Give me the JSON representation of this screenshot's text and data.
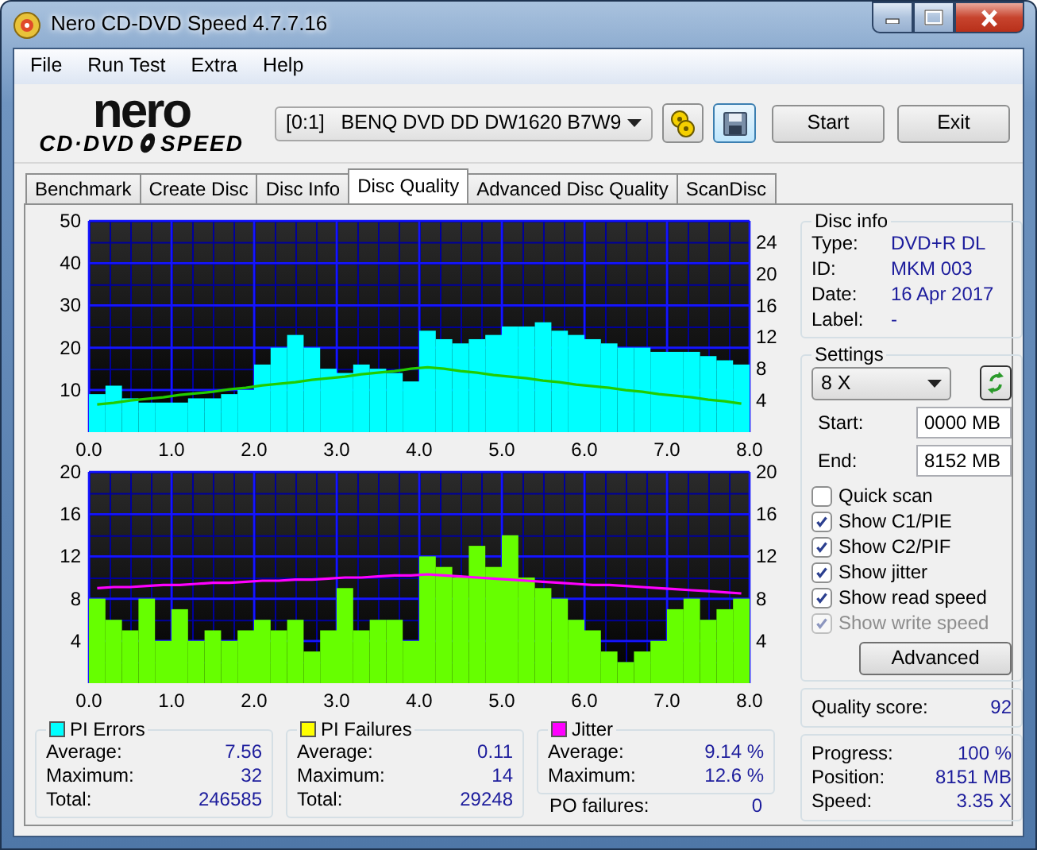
{
  "window": {
    "title": "Nero CD-DVD Speed 4.7.7.16"
  },
  "menu": [
    "File",
    "Run Test",
    "Extra",
    "Help"
  ],
  "logo": {
    "top": "nero",
    "bottom_left": "CD·DVD",
    "bottom_right": "SPEED"
  },
  "toolbar": {
    "drive": "[0:1]   BENQ DVD DD DW1620 B7W9",
    "buttons": [
      "Start",
      "Exit"
    ]
  },
  "tabs": [
    {
      "label": "Benchmark",
      "selected": false
    },
    {
      "label": "Create Disc",
      "selected": false
    },
    {
      "label": "Disc Info",
      "selected": false
    },
    {
      "label": "Disc Quality",
      "selected": true
    },
    {
      "label": "Advanced Disc Quality",
      "selected": false
    },
    {
      "label": "ScanDisc",
      "selected": false
    }
  ],
  "charts": [
    {
      "chart_data": {
        "type": "bar",
        "grid": true,
        "x": [
          0.1,
          0.3,
          0.5,
          0.7,
          0.9,
          1.1,
          1.3,
          1.5,
          1.7,
          1.9,
          2.1,
          2.3,
          2.5,
          2.7,
          2.9,
          3.1,
          3.3,
          3.5,
          3.7,
          3.9,
          4.1,
          4.3,
          4.5,
          4.7,
          4.9,
          5.1,
          5.3,
          5.5,
          5.7,
          5.9,
          6.1,
          6.3,
          6.5,
          6.7,
          6.9,
          7.1,
          7.3,
          7.5,
          7.7,
          7.9
        ],
        "xlim": [
          0,
          8
        ],
        "ylim": [
          0,
          50
        ],
        "y2lim": [
          0,
          26.7
        ],
        "xticks": [
          {
            "value": 0,
            "label": "0.0"
          },
          {
            "value": 1,
            "label": "1.0"
          },
          {
            "value": 2,
            "label": "2.0"
          },
          {
            "value": 3,
            "label": "3.0"
          },
          {
            "value": 4,
            "label": "4.0"
          },
          {
            "value": 5,
            "label": "5.0"
          },
          {
            "value": 6,
            "label": "6.0"
          },
          {
            "value": 7,
            "label": "7.0"
          },
          {
            "value": 8,
            "label": "8.0"
          }
        ],
        "yticks": [
          10,
          20,
          30,
          40,
          50
        ],
        "y2ticks": [
          4,
          8,
          12,
          16,
          20,
          24
        ],
        "series": [
          {
            "type": "bar",
            "color": "#00ffff",
            "values": [
              9,
              11,
              8,
              7,
              7,
              7,
              8,
              8,
              9,
              10,
              16,
              20,
              23,
              20,
              15,
              14,
              16,
              15,
              14,
              12,
              24,
              22,
              21,
              22,
              23,
              25,
              25,
              26,
              24,
              23,
              22,
              21,
              20,
              20,
              19,
              19,
              19,
              18,
              17,
              16
            ]
          },
          {
            "type": "line",
            "axis": "y2",
            "color": "#22cc00",
            "values": [
              3.5,
              3.7,
              4.0,
              4.2,
              4.4,
              4.7,
              4.9,
              5.1,
              5.4,
              5.6,
              5.9,
              6.1,
              6.3,
              6.6,
              6.8,
              7.0,
              7.3,
              7.5,
              7.7,
              8.0,
              8.2,
              8.0,
              7.7,
              7.5,
              7.2,
              7.0,
              6.8,
              6.5,
              6.3,
              6.0,
              5.8,
              5.6,
              5.3,
              5.1,
              4.8,
              4.6,
              4.4,
              4.1,
              3.9,
              3.6
            ]
          }
        ]
      }
    },
    {
      "chart_data": {
        "type": "bar",
        "grid": true,
        "x": [
          0.1,
          0.3,
          0.5,
          0.7,
          0.9,
          1.1,
          1.3,
          1.5,
          1.7,
          1.9,
          2.1,
          2.3,
          2.5,
          2.7,
          2.9,
          3.1,
          3.3,
          3.5,
          3.7,
          3.9,
          4.1,
          4.3,
          4.5,
          4.7,
          4.9,
          5.1,
          5.3,
          5.5,
          5.7,
          5.9,
          6.1,
          6.3,
          6.5,
          6.7,
          6.9,
          7.1,
          7.3,
          7.5,
          7.7,
          7.9
        ],
        "xlim": [
          0,
          8
        ],
        "ylim": [
          0,
          20
        ],
        "y2lim": [
          0,
          20
        ],
        "xticks": [
          {
            "value": 0,
            "label": "0.0"
          },
          {
            "value": 1,
            "label": "1.0"
          },
          {
            "value": 2,
            "label": "2.0"
          },
          {
            "value": 3,
            "label": "3.0"
          },
          {
            "value": 4,
            "label": "4.0"
          },
          {
            "value": 5,
            "label": "5.0"
          },
          {
            "value": 6,
            "label": "6.0"
          },
          {
            "value": 7,
            "label": "7.0"
          },
          {
            "value": 8,
            "label": "8.0"
          }
        ],
        "yticks": [
          4,
          8,
          12,
          16,
          20
        ],
        "y2ticks": [
          4,
          8,
          12,
          16,
          20
        ],
        "series": [
          {
            "type": "bar",
            "color": "#66ff00",
            "values": [
              8,
              6,
              5,
              8,
              4,
              7,
              4,
              5,
              4,
              5,
              6,
              5,
              6,
              3,
              5,
              9,
              5,
              6,
              6,
              4,
              12,
              11,
              10,
              13,
              11,
              14,
              10,
              9,
              8,
              6,
              5,
              3,
              2,
              3,
              4,
              7,
              8,
              6,
              7,
              8
            ]
          },
          {
            "type": "line",
            "axis": "y2",
            "color": "#ff00ff",
            "values": [
              9.0,
              9.1,
              9.1,
              9.2,
              9.3,
              9.3,
              9.4,
              9.5,
              9.5,
              9.6,
              9.7,
              9.7,
              9.8,
              9.8,
              9.9,
              10.0,
              10.0,
              10.1,
              10.2,
              10.2,
              10.3,
              10.2,
              10.1,
              10.0,
              9.9,
              9.8,
              9.7,
              9.6,
              9.5,
              9.4,
              9.3,
              9.3,
              9.2,
              9.1,
              9.0,
              8.9,
              8.8,
              8.7,
              8.6,
              8.5
            ]
          }
        ]
      }
    }
  ],
  "stats": {
    "groups": [
      {
        "title": "PI Errors",
        "color": "#00ffff",
        "rows": [
          {
            "label": "Average:",
            "value": "7.56"
          },
          {
            "label": "Maximum:",
            "value": "32"
          },
          {
            "label": "Total:",
            "value": "246585"
          }
        ]
      },
      {
        "title": "PI Failures",
        "color": "#ffff00",
        "rows": [
          {
            "label": "Average:",
            "value": "0.11"
          },
          {
            "label": "Maximum:",
            "value": "14"
          },
          {
            "label": "Total:",
            "value": "29248"
          }
        ]
      },
      {
        "title": "Jitter",
        "color": "#ff00ff",
        "rows": [
          {
            "label": "Average:",
            "value": "9.14 %"
          },
          {
            "label": "Maximum:",
            "value": "12.6 %"
          }
        ]
      }
    ],
    "po_failures": {
      "label": "PO failures:",
      "value": "0"
    }
  },
  "disc_info": {
    "title": "Disc info",
    "rows": [
      {
        "label": "Type:",
        "value": "DVD+R DL"
      },
      {
        "label": "ID:",
        "value": "MKM 003"
      },
      {
        "label": "Date:",
        "value": "16 Apr 2017"
      },
      {
        "label": "Label:",
        "value": "-"
      }
    ]
  },
  "settings": {
    "title": "Settings",
    "speed": "8 X",
    "start_label": "Start:",
    "start_value": "0000 MB",
    "end_label": "End:",
    "end_value": "8152 MB",
    "options": [
      {
        "label": "Quick scan",
        "checked": false,
        "disabled": false
      },
      {
        "label": "Show C1/PIE",
        "checked": true,
        "disabled": false
      },
      {
        "label": "Show C2/PIF",
        "checked": true,
        "disabled": false
      },
      {
        "label": "Show jitter",
        "checked": true,
        "disabled": false
      },
      {
        "label": "Show read speed",
        "checked": true,
        "disabled": false
      },
      {
        "label": "Show write speed",
        "checked": true,
        "disabled": true
      }
    ],
    "advanced_button": "Advanced"
  },
  "quality_score": {
    "label": "Quality score:",
    "value": "92"
  },
  "progress": {
    "rows": [
      {
        "label": "Progress:",
        "value": "100 %"
      },
      {
        "label": "Position:",
        "value": "8151 MB"
      },
      {
        "label": "Speed:",
        "value": "3.35 X"
      }
    ]
  }
}
